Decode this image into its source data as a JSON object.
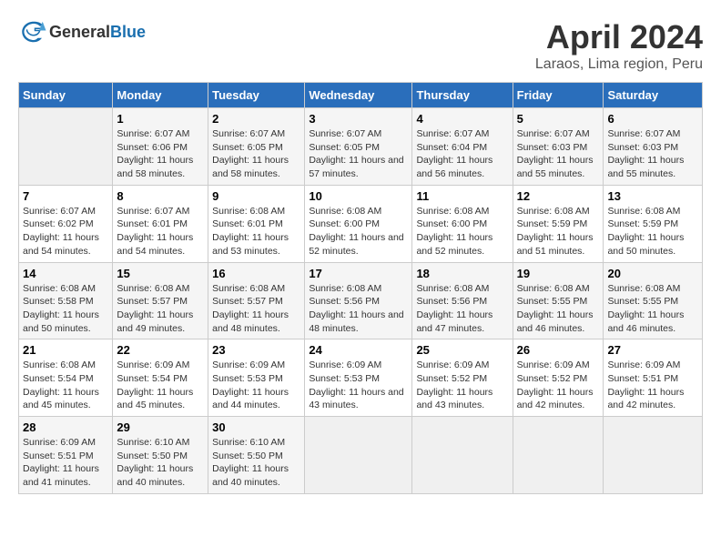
{
  "header": {
    "logo_general": "General",
    "logo_blue": "Blue",
    "month_year": "April 2024",
    "location": "Laraos, Lima region, Peru"
  },
  "days_of_week": [
    "Sunday",
    "Monday",
    "Tuesday",
    "Wednesday",
    "Thursday",
    "Friday",
    "Saturday"
  ],
  "weeks": [
    [
      {
        "day": "",
        "empty": true
      },
      {
        "day": "1",
        "sunrise": "Sunrise: 6:07 AM",
        "sunset": "Sunset: 6:06 PM",
        "daylight": "Daylight: 11 hours and 58 minutes."
      },
      {
        "day": "2",
        "sunrise": "Sunrise: 6:07 AM",
        "sunset": "Sunset: 6:05 PM",
        "daylight": "Daylight: 11 hours and 58 minutes."
      },
      {
        "day": "3",
        "sunrise": "Sunrise: 6:07 AM",
        "sunset": "Sunset: 6:05 PM",
        "daylight": "Daylight: 11 hours and 57 minutes."
      },
      {
        "day": "4",
        "sunrise": "Sunrise: 6:07 AM",
        "sunset": "Sunset: 6:04 PM",
        "daylight": "Daylight: 11 hours and 56 minutes."
      },
      {
        "day": "5",
        "sunrise": "Sunrise: 6:07 AM",
        "sunset": "Sunset: 6:03 PM",
        "daylight": "Daylight: 11 hours and 55 minutes."
      },
      {
        "day": "6",
        "sunrise": "Sunrise: 6:07 AM",
        "sunset": "Sunset: 6:03 PM",
        "daylight": "Daylight: 11 hours and 55 minutes."
      }
    ],
    [
      {
        "day": "7",
        "sunrise": "Sunrise: 6:07 AM",
        "sunset": "Sunset: 6:02 PM",
        "daylight": "Daylight: 11 hours and 54 minutes."
      },
      {
        "day": "8",
        "sunrise": "Sunrise: 6:07 AM",
        "sunset": "Sunset: 6:01 PM",
        "daylight": "Daylight: 11 hours and 54 minutes."
      },
      {
        "day": "9",
        "sunrise": "Sunrise: 6:08 AM",
        "sunset": "Sunset: 6:01 PM",
        "daylight": "Daylight: 11 hours and 53 minutes."
      },
      {
        "day": "10",
        "sunrise": "Sunrise: 6:08 AM",
        "sunset": "Sunset: 6:00 PM",
        "daylight": "Daylight: 11 hours and 52 minutes."
      },
      {
        "day": "11",
        "sunrise": "Sunrise: 6:08 AM",
        "sunset": "Sunset: 6:00 PM",
        "daylight": "Daylight: 11 hours and 52 minutes."
      },
      {
        "day": "12",
        "sunrise": "Sunrise: 6:08 AM",
        "sunset": "Sunset: 5:59 PM",
        "daylight": "Daylight: 11 hours and 51 minutes."
      },
      {
        "day": "13",
        "sunrise": "Sunrise: 6:08 AM",
        "sunset": "Sunset: 5:59 PM",
        "daylight": "Daylight: 11 hours and 50 minutes."
      }
    ],
    [
      {
        "day": "14",
        "sunrise": "Sunrise: 6:08 AM",
        "sunset": "Sunset: 5:58 PM",
        "daylight": "Daylight: 11 hours and 50 minutes."
      },
      {
        "day": "15",
        "sunrise": "Sunrise: 6:08 AM",
        "sunset": "Sunset: 5:57 PM",
        "daylight": "Daylight: 11 hours and 49 minutes."
      },
      {
        "day": "16",
        "sunrise": "Sunrise: 6:08 AM",
        "sunset": "Sunset: 5:57 PM",
        "daylight": "Daylight: 11 hours and 48 minutes."
      },
      {
        "day": "17",
        "sunrise": "Sunrise: 6:08 AM",
        "sunset": "Sunset: 5:56 PM",
        "daylight": "Daylight: 11 hours and 48 minutes."
      },
      {
        "day": "18",
        "sunrise": "Sunrise: 6:08 AM",
        "sunset": "Sunset: 5:56 PM",
        "daylight": "Daylight: 11 hours and 47 minutes."
      },
      {
        "day": "19",
        "sunrise": "Sunrise: 6:08 AM",
        "sunset": "Sunset: 5:55 PM",
        "daylight": "Daylight: 11 hours and 46 minutes."
      },
      {
        "day": "20",
        "sunrise": "Sunrise: 6:08 AM",
        "sunset": "Sunset: 5:55 PM",
        "daylight": "Daylight: 11 hours and 46 minutes."
      }
    ],
    [
      {
        "day": "21",
        "sunrise": "Sunrise: 6:08 AM",
        "sunset": "Sunset: 5:54 PM",
        "daylight": "Daylight: 11 hours and 45 minutes."
      },
      {
        "day": "22",
        "sunrise": "Sunrise: 6:09 AM",
        "sunset": "Sunset: 5:54 PM",
        "daylight": "Daylight: 11 hours and 45 minutes."
      },
      {
        "day": "23",
        "sunrise": "Sunrise: 6:09 AM",
        "sunset": "Sunset: 5:53 PM",
        "daylight": "Daylight: 11 hours and 44 minutes."
      },
      {
        "day": "24",
        "sunrise": "Sunrise: 6:09 AM",
        "sunset": "Sunset: 5:53 PM",
        "daylight": "Daylight: 11 hours and 43 minutes."
      },
      {
        "day": "25",
        "sunrise": "Sunrise: 6:09 AM",
        "sunset": "Sunset: 5:52 PM",
        "daylight": "Daylight: 11 hours and 43 minutes."
      },
      {
        "day": "26",
        "sunrise": "Sunrise: 6:09 AM",
        "sunset": "Sunset: 5:52 PM",
        "daylight": "Daylight: 11 hours and 42 minutes."
      },
      {
        "day": "27",
        "sunrise": "Sunrise: 6:09 AM",
        "sunset": "Sunset: 5:51 PM",
        "daylight": "Daylight: 11 hours and 42 minutes."
      }
    ],
    [
      {
        "day": "28",
        "sunrise": "Sunrise: 6:09 AM",
        "sunset": "Sunset: 5:51 PM",
        "daylight": "Daylight: 11 hours and 41 minutes."
      },
      {
        "day": "29",
        "sunrise": "Sunrise: 6:10 AM",
        "sunset": "Sunset: 5:50 PM",
        "daylight": "Daylight: 11 hours and 40 minutes."
      },
      {
        "day": "30",
        "sunrise": "Sunrise: 6:10 AM",
        "sunset": "Sunset: 5:50 PM",
        "daylight": "Daylight: 11 hours and 40 minutes."
      },
      {
        "day": "",
        "empty": true
      },
      {
        "day": "",
        "empty": true
      },
      {
        "day": "",
        "empty": true
      },
      {
        "day": "",
        "empty": true
      }
    ]
  ]
}
